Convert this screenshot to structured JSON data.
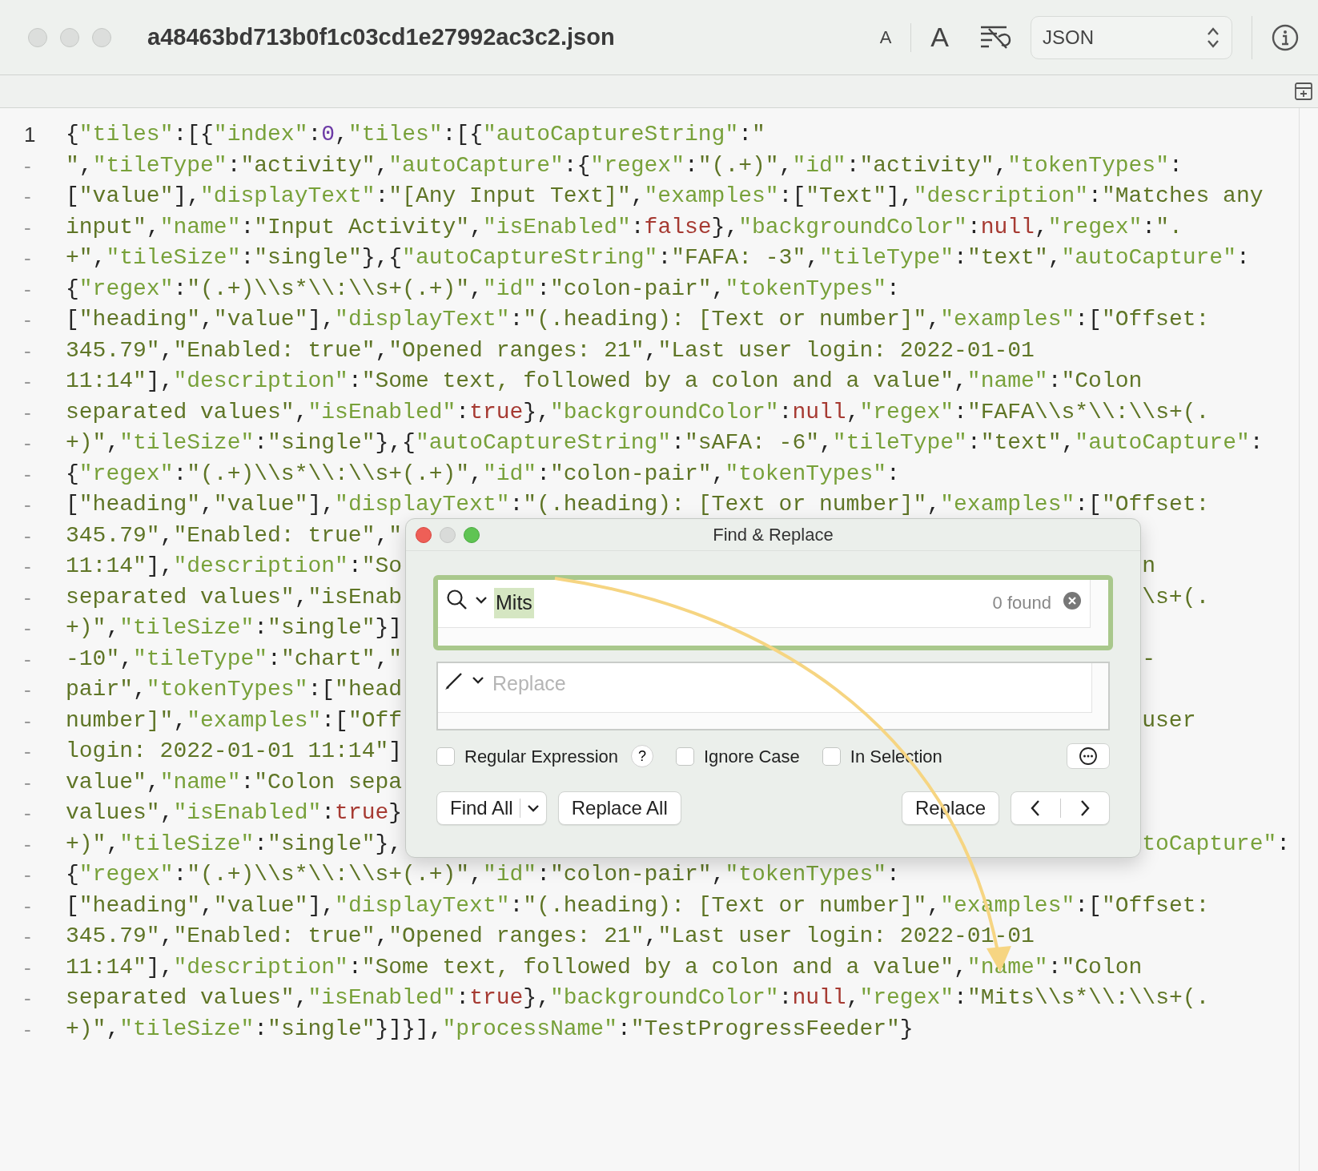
{
  "window": {
    "title": "a48463bd713b0f1c03cd1e27992ac3c2.json",
    "font_smaller": "A",
    "font_larger": "A",
    "syntax": "JSON"
  },
  "editor": {
    "lines": [
      {
        "gutter": "1",
        "segments": [
          {
            "text": "{\"tiles\":[{\"index\":0,\"tiles\":[{\"autoCaptureString\":\""
          }
        ]
      },
      {
        "gutter": "-",
        "segments": [
          {
            "text": "\",\"tileType\":\"activity\",\"autoCapture\":{\"regex\":\"(.+)\",\"id\":\"activity\",\"tokenTypes\":"
          }
        ]
      },
      {
        "gutter": "-",
        "segments": [
          {
            "text": "[\"value\"],\"displayText\":\"[Any Input Text]\",\"examples\":[\"Text\"],\"description\":\"Matches any"
          }
        ]
      },
      {
        "gutter": "-",
        "segments": [
          {
            "text": "input\",\"name\":\"Input Activity\",\"isEnabled\":false},\"backgroundColor\":null,\"regex\":\"."
          }
        ]
      },
      {
        "gutter": "-",
        "segments": [
          {
            "text": "+\",\"tileSize\":\"single\"},{\"autoCaptureString\":\"FAFA: -3\",\"tileType\":\"text\",\"autoCapture\":"
          }
        ]
      },
      {
        "gutter": "-",
        "segments": [
          {
            "text": "{\"regex\":\"(.+)\\\\s*\\\\:\\\\s+(.+)\",\"id\":\"colon-pair\",\"tokenTypes\":"
          }
        ]
      },
      {
        "gutter": "-",
        "segments": [
          {
            "text": "[\"heading\",\"value\"],\"displayText\":\"(.heading): [Text or number]\",\"examples\":[\"Offset:"
          }
        ]
      },
      {
        "gutter": "-",
        "segments": [
          {
            "text": "345.79\",\"Enabled: true\",\"Opened ranges: 21\",\"Last user login: 2022-01-01"
          }
        ]
      },
      {
        "gutter": "-",
        "segments": [
          {
            "text": "11:14\"],\"description\":\"Some text, followed by a colon and a value\",\"name\":\"Colon"
          }
        ]
      },
      {
        "gutter": "-",
        "segments": [
          {
            "text": "separated values\",\"isEnabled\":true},\"backgroundColor\":null,\"regex\":\"FAFA\\\\s*\\\\:\\\\s+(."
          }
        ]
      },
      {
        "gutter": "-",
        "segments": [
          {
            "text": "+)\",\"tileSize\":\"single\"},{\"autoCaptureString\":\"sAFA: -6\",\"tileType\":\"text\",\"autoCapture\":"
          }
        ]
      },
      {
        "gutter": "-",
        "segments": [
          {
            "text": "{\"regex\":\"(.+)\\\\s*\\\\:\\\\s+(.+)\",\"id\":\"colon-pair\",\"tokenTypes\":"
          }
        ]
      },
      {
        "gutter": "-",
        "segments": [
          {
            "text": "[\"heading\",\"value\"],\"displayText\":\"(.heading): [Text or number]\",\"examples\":[\"Offset:"
          }
        ]
      },
      {
        "gutter": "-",
        "segments": [
          {
            "text": "345.79\",\"Enabled: true\",\""
          }
        ]
      },
      {
        "gutter": "-",
        "segments": [
          {
            "text": "11:14\"],\"description\":\"So"
          },
          {
            "text": "n",
            "starts_in_string": true
          }
        ]
      },
      {
        "gutter": "-",
        "segments": [
          {
            "text": "separated values\",\"isEnab"
          },
          {
            "text": "\\s+(.",
            "starts_in_string": true
          }
        ]
      },
      {
        "gutter": "-",
        "segments": [
          {
            "text": "+)\",\"tileSize\":\"single\"}]"
          }
        ]
      },
      {
        "gutter": "-",
        "segments": [
          {
            "text": "-10\",\"tileType\":\"chart\",\"",
            "starts_in_string": true
          },
          {
            "text": "-",
            "starts_in_string": true
          }
        ]
      },
      {
        "gutter": "-",
        "segments": [
          {
            "text": "pair\",\"tokenTypes\":[\"head"
          }
        ]
      },
      {
        "gutter": "-",
        "segments": [
          {
            "text": "number]\",\"examples\":[\"Off"
          },
          {
            "text": "user",
            "starts_in_string": true
          }
        ]
      },
      {
        "gutter": "-",
        "segments": [
          {
            "text": "login: 2022-01-01 11:14\"]"
          }
        ]
      },
      {
        "gutter": "-",
        "segments": [
          {
            "text": "value\",\"name\":\"Colon sepa",
            "starts_in_string": true
          }
        ]
      },
      {
        "gutter": "-",
        "segments": [
          {
            "text": "values\",\"isEnabled\":true}"
          }
        ]
      },
      {
        "gutter": "-",
        "segments": [
          {
            "text": "+)\",\"tileSize\":\"single\"},",
            "starts_in_string": true
          },
          {
            "text": "toCapture\":",
            "starts_in_string": true
          }
        ]
      },
      {
        "gutter": "-",
        "segments": [
          {
            "text": "{\"regex\":\"(.+)\\\\s*\\\\:\\\\s+(.+)\",\"id\":\"colon-pair\",\"tokenTypes\":"
          }
        ]
      },
      {
        "gutter": "-",
        "segments": [
          {
            "text": "[\"heading\",\"value\"],\"displayText\":\"(.heading): [Text or number]\",\"examples\":[\"Offset:"
          }
        ]
      },
      {
        "gutter": "-",
        "segments": [
          {
            "text": "345.79\",\"Enabled: true\",\"Opened ranges: 21\",\"Last user login: 2022-01-01"
          }
        ]
      },
      {
        "gutter": "-",
        "segments": [
          {
            "text": "11:14\"],\"description\":\"Some text, followed by a colon and a value\",\"name\":\"Colon"
          }
        ]
      },
      {
        "gutter": "-",
        "segments": [
          {
            "text": "separated values\",\"isEnabled\":true},\"backgroundColor\":null,\"regex\":\"Mits\\\\s*\\\\:\\\\s+(."
          }
        ]
      },
      {
        "gutter": "-",
        "segments": [
          {
            "text": "+)\",\"tileSize\":\"single\"}]}],\"processName\":\"TestProgressFeeder\"}"
          }
        ]
      }
    ]
  },
  "find_dialog": {
    "title": "Find & Replace",
    "search": {
      "value": "Mits",
      "value_selected": true,
      "match_count": "0 found"
    },
    "replace": {
      "placeholder": "Replace"
    },
    "options": [
      {
        "label": "Regular Expression",
        "checked": false
      },
      {
        "label": "Ignore Case",
        "checked": false
      },
      {
        "label": "In Selection",
        "checked": false
      }
    ],
    "help_button": "?",
    "buttons": [
      {
        "label": "Find All",
        "kind": "split"
      },
      {
        "label": "Replace All",
        "kind": "plain"
      },
      {
        "label": "Replace",
        "kind": "plain"
      }
    ]
  }
}
